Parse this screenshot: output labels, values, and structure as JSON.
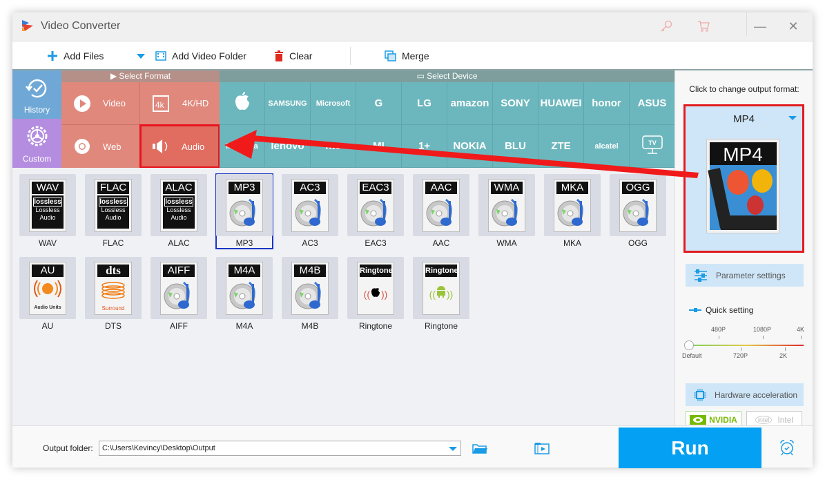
{
  "app": {
    "title": "Video Converter"
  },
  "toolbar": {
    "add_files": "Add Files",
    "add_video_folder": "Add Video Folder",
    "clear": "Clear",
    "merge": "Merge"
  },
  "left_tabs": [
    {
      "label": "History",
      "icon": "history-icon",
      "color": "#6fa8d6"
    },
    {
      "label": "Custom",
      "icon": "gear-icon",
      "color": "#b48de0"
    }
  ],
  "select_format": {
    "header": "Select Format",
    "items": [
      {
        "label": "Video",
        "icon": "play-icon"
      },
      {
        "label": "4K/HD",
        "icon": "4k-icon"
      },
      {
        "label": "Web",
        "icon": "chrome-icon"
      },
      {
        "label": "Audio",
        "icon": "speaker-icon",
        "active": true
      }
    ]
  },
  "select_device": {
    "header": "Select Device",
    "row1": [
      "Apple",
      "SAMSUNG",
      "Microsoft",
      "G",
      "LG",
      "amazon",
      "SONY",
      "HUAWEI",
      "honor",
      "ASUS"
    ],
    "row2": [
      "Motorola",
      "lenovo",
      "htc",
      "MI",
      "1+",
      "NOKIA",
      "BLU",
      "ZTE",
      "alcatel",
      "TV"
    ]
  },
  "audio_formats": [
    {
      "band": "WAV",
      "name": "WAV",
      "type": "lossless"
    },
    {
      "band": "FLAC",
      "name": "FLAC",
      "type": "lossless"
    },
    {
      "band": "ALAC",
      "name": "ALAC",
      "type": "lossless"
    },
    {
      "band": "MP3",
      "name": "MP3",
      "type": "disc",
      "selected": true
    },
    {
      "band": "AC3",
      "name": "AC3",
      "type": "disc"
    },
    {
      "band": "EAC3",
      "name": "EAC3",
      "type": "disc"
    },
    {
      "band": "AAC",
      "name": "AAC",
      "type": "disc"
    },
    {
      "band": "WMA",
      "name": "WMA",
      "type": "disc"
    },
    {
      "band": "MKA",
      "name": "MKA",
      "type": "disc"
    },
    {
      "band": "OGG",
      "name": "OGG",
      "type": "disc"
    },
    {
      "band": "AU",
      "name": "AU",
      "type": "au"
    },
    {
      "band": "dts",
      "name": "DTS",
      "type": "dts"
    },
    {
      "band": "AIFF",
      "name": "AIFF",
      "type": "disc"
    },
    {
      "band": "M4A",
      "name": "M4A",
      "type": "disc"
    },
    {
      "band": "M4B",
      "name": "M4B",
      "type": "disc"
    },
    {
      "band": "Ringtone",
      "name": "Ringtone",
      "type": "ring-apple"
    },
    {
      "band": "Ringtone",
      "name": "Ringtone",
      "type": "ring-android"
    }
  ],
  "lossless_text": {
    "badge": "lossless",
    "line1": "Lossless",
    "line2": "Audio"
  },
  "au_text": "Audio Units",
  "dts_text": "Surround",
  "right_panel": {
    "hint": "Click to change output format:",
    "output_format": "MP4",
    "thumb_label": "MP4",
    "parameter_settings": "Parameter settings",
    "quick_setting": "Quick setting",
    "slider": {
      "top_labels": [
        "480P",
        "1080P",
        "4K"
      ],
      "bottom_labels": [
        "Default",
        "720P",
        "2K"
      ],
      "value": "Default"
    },
    "hardware_acceleration": "Hardware acceleration",
    "nvidia": "NVIDIA",
    "intel": "Intel"
  },
  "bottom": {
    "output_folder_label": "Output folder:",
    "output_folder_value": "C:\\Users\\Kevincy\\Desktop\\Output",
    "run": "Run"
  },
  "colors": {
    "accent": "#03a0f3",
    "format_panel": "#e0887c",
    "device_panel": "#6cb7bd",
    "annotation_red": "#e8131d"
  }
}
